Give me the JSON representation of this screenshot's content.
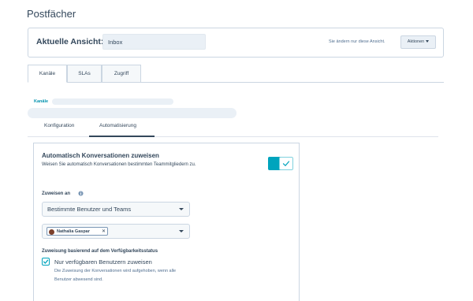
{
  "page": {
    "title": "Postfächer"
  },
  "view": {
    "label": "Aktuelle Ansicht:",
    "input_value": "Inbox",
    "note": "Sie ändern nur diese Ansicht.",
    "actions_label": "Aktionen"
  },
  "tabs": [
    {
      "label": "Kanäle",
      "active": true
    },
    {
      "label": "SLAs",
      "active": false
    },
    {
      "label": "Zugriff",
      "active": false
    }
  ],
  "channels": {
    "label": "Kanäle"
  },
  "subtabs": [
    {
      "label": "Konfiguration",
      "active": false
    },
    {
      "label": "Automatisierung",
      "active": true
    }
  ],
  "automation": {
    "title": "Automatisch Konversationen zuweisen",
    "description": "Weisen Sie automatisch Konversationen bestimmten Teammitgliedern zu.",
    "toggle_on": true,
    "assign_label": "Zuweisen an",
    "assign_select": "Bestimmte Benutzer und Teams",
    "selected_user": "Nathalia Gaspar",
    "availability_title": "Zuweisung basierend auf dem Verfügbarkeitsstatus",
    "checkbox_checked": true,
    "checkbox_label": "Nur verfügbaren Benutzern zuweisen",
    "help_line1": "Die Zuweisung der Konversationen wird aufgehoben, wenn alle",
    "help_line2": "Benutzer abwesend sind."
  },
  "colors": {
    "accent": "#00a4bd",
    "text": "#33475b",
    "border": "#cbd6e2",
    "link": "#0091ae"
  }
}
